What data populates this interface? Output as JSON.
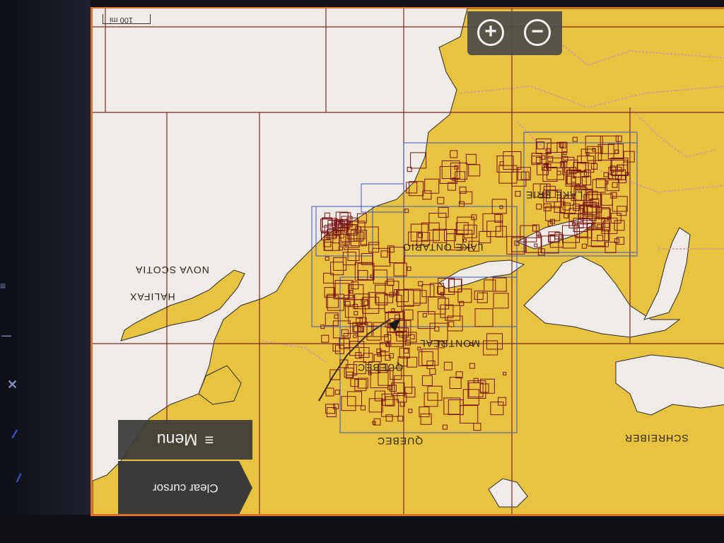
{
  "map": {
    "scale_label": "100 mi",
    "labels": {
      "nova_scotia": "NOVA SCOTIA",
      "halifax": "HALIFAX",
      "lake_ontario": "LAKE ONTARIO",
      "lake_erie": "LAKE ERIE",
      "montreal": "MONTREAL",
      "quebec_city": "QUEBEC",
      "quebec_province": "QUEBEC",
      "schreiber": "SCHREIBER"
    },
    "colors": {
      "land": "#e9c23f",
      "water": "#efebe6",
      "chart_boxes": "#7a1414",
      "chart_outlines": "#3c55c8",
      "grid": "#7a2a2a",
      "border": "#d98fb0",
      "accent": "#e26d2c"
    }
  },
  "controls": {
    "zoom_in": "+",
    "zoom_out": "−",
    "menu_icon": "≡",
    "menu_label": "Menu",
    "clear_cursor_label": "Clear cursor"
  },
  "bezel": {
    "icons": [
      "menu-lines-icon",
      "minus-icon",
      "close-icon",
      "slash-icon",
      "slash-icon"
    ],
    "glyphs": [
      "≡",
      "—",
      "✕",
      "/",
      "/"
    ]
  }
}
